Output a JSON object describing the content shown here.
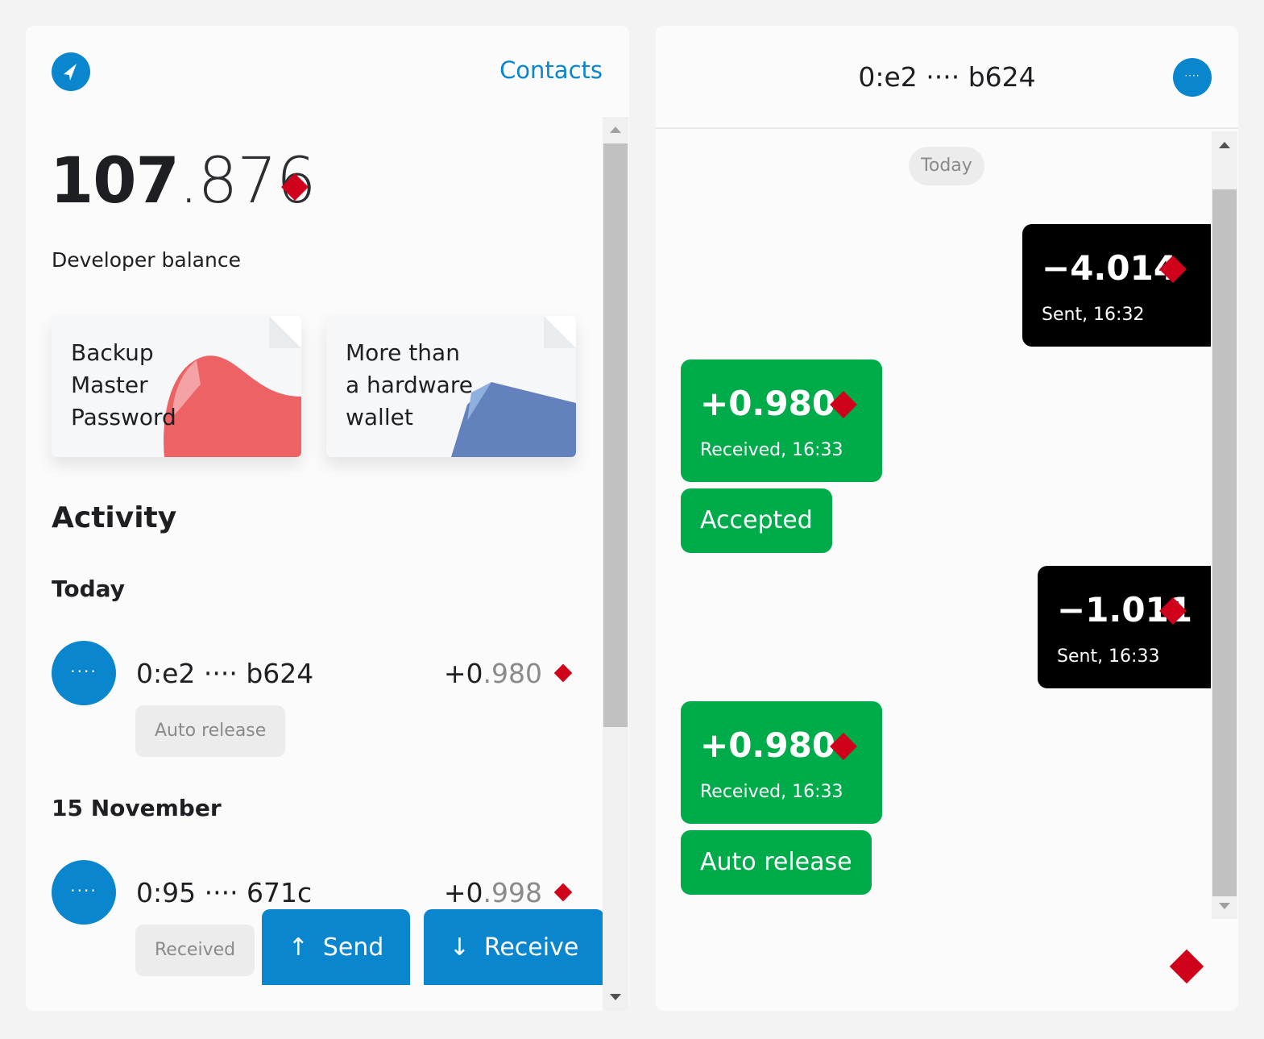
{
  "colors": {
    "accent": "#0a86ce",
    "green": "#00ac4a",
    "coin": "#d0021b",
    "sent_bg": "#000000"
  },
  "header": {
    "logo_icon": "arrow-logo-icon",
    "contacts_label": "Contacts"
  },
  "balance": {
    "integer": "107",
    "fraction": ".876",
    "label": "Developer balance",
    "icon": "coin-diamond-icon"
  },
  "cards": [
    {
      "title_lines": [
        "Backup",
        "Master",
        "Password"
      ]
    },
    {
      "title_lines": [
        "More than",
        "a hardware",
        "wallet"
      ]
    }
  ],
  "activity": {
    "title": "Activity",
    "groups": [
      {
        "date": "Today",
        "items": [
          {
            "avatar": "····",
            "address": "0:e2 ···· b624",
            "amount_sign": "+",
            "amount_whole": "0",
            "amount_frac": ".980",
            "tag": "Auto release"
          }
        ]
      },
      {
        "date": "15 November",
        "items": [
          {
            "avatar": "····",
            "address": "0:95 ···· 671c",
            "amount_sign": "+",
            "amount_whole": "0",
            "amount_frac": ".998",
            "tag": "Received"
          }
        ]
      }
    ]
  },
  "actions": {
    "send_icon": "↑",
    "send_label": "Send",
    "receive_icon": "↓",
    "receive_label": "Receive"
  },
  "chat": {
    "title": "0:e2 ···· b624",
    "more_icon": "····",
    "day_label": "Today",
    "messages": [
      {
        "type": "sent",
        "amount": "−4.014",
        "sub": "Sent, 16:32"
      },
      {
        "type": "received",
        "amount": "+0.980",
        "sub": "Received, 16:33",
        "status": "Accepted"
      },
      {
        "type": "sent",
        "amount": "−1.011",
        "sub": "Sent, 16:33"
      },
      {
        "type": "received",
        "amount": "+0.980",
        "sub": "Received, 16:33",
        "status": "Auto release"
      }
    ]
  }
}
